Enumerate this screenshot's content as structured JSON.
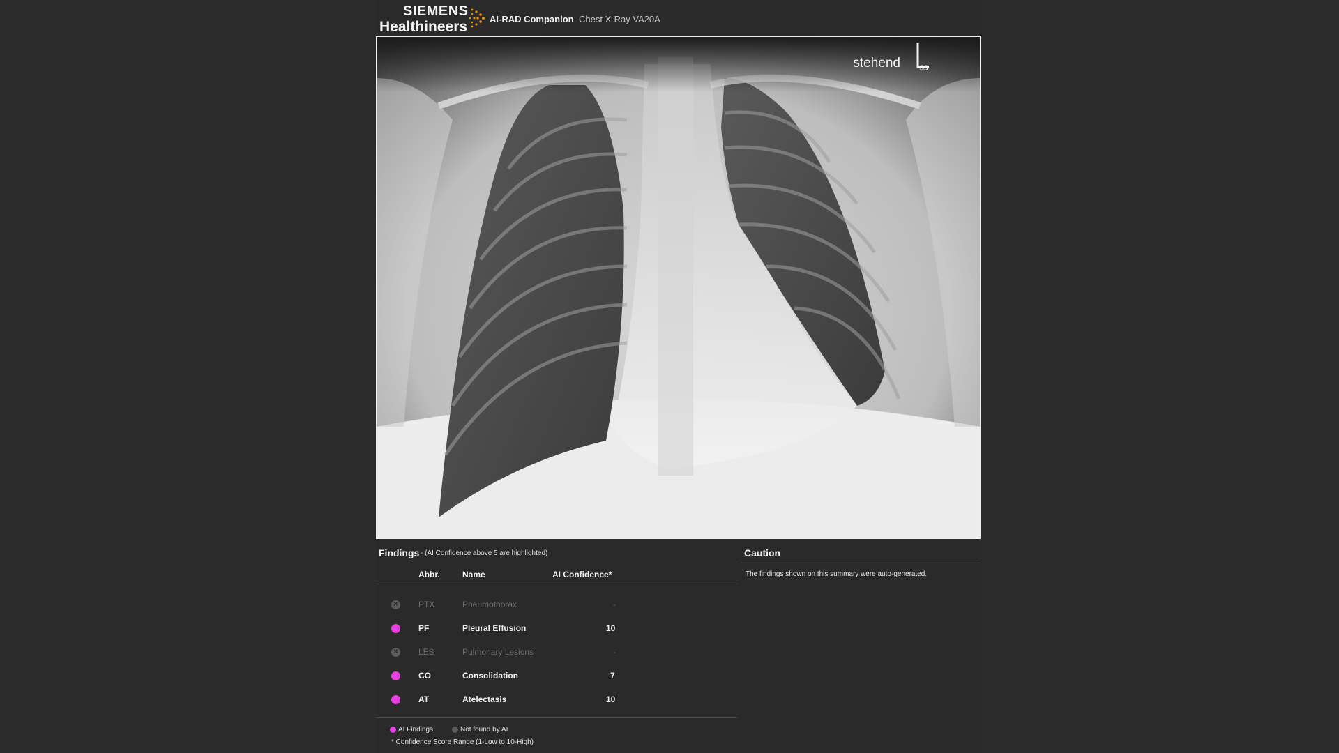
{
  "header": {
    "brand_line1": "SIEMENS",
    "brand_line2": "Healthineers",
    "product": "AI-RAD Companion",
    "version": "Chest X-Ray VA20A"
  },
  "image": {
    "position_label": "stehend",
    "marker_letter": "L",
    "marker_number": "39"
  },
  "findings": {
    "title": "Findings",
    "subtitle": "- (AI Confidence above 5 are highlighted)",
    "columns": {
      "abbr": "Abbr.",
      "name": "Name",
      "confidence": "AI Confidence*"
    },
    "rows": [
      {
        "abbr": "PTX",
        "name": "Pneumothorax",
        "confidence": "-",
        "found": false
      },
      {
        "abbr": "PF",
        "name": "Pleural Effusion",
        "confidence": "10",
        "found": true
      },
      {
        "abbr": "LES",
        "name": "Pulmonary Lesions",
        "confidence": "-",
        "found": false
      },
      {
        "abbr": "CO",
        "name": "Consolidation",
        "confidence": "7",
        "found": true
      },
      {
        "abbr": "AT",
        "name": "Atelectasis",
        "confidence": "10",
        "found": true
      }
    ],
    "legend": {
      "ai_findings": "AI Findings",
      "not_found": "Not found by AI",
      "footnote": "* Confidence Score Range (1-Low to 10-High)"
    }
  },
  "caution": {
    "title": "Caution",
    "text": "The findings shown on this summary were auto-generated."
  },
  "colors": {
    "background": "#2a2a2a",
    "highlight": "#e63fe0",
    "muted": "#6c6c6c"
  }
}
